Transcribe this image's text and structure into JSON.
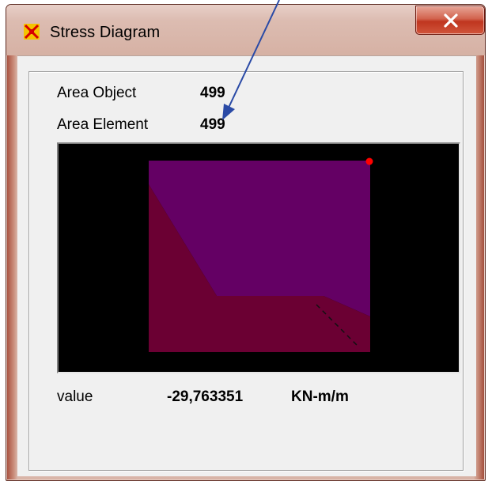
{
  "window": {
    "title": "Stress Diagram",
    "close_label": "x"
  },
  "info": {
    "area_object_label": "Area Object",
    "area_object_value": "499",
    "area_element_label": "Area Element",
    "area_element_value": "499"
  },
  "readout": {
    "value_label": "value",
    "value": "-29,763351",
    "unit": "KN-m/m"
  },
  "colors": {
    "upper_region": "#640064",
    "lower_region": "#6b0033",
    "marker": "#ff0000",
    "annotation_arrow": "#2a4aa6"
  },
  "icons": [
    "app-icon",
    "close-icon",
    "annotation-arrow-icon"
  ]
}
